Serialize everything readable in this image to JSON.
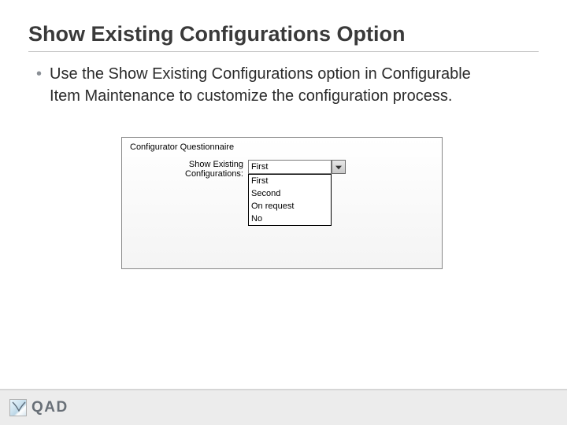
{
  "title": "Show Existing Configurations Option",
  "bullet": "•",
  "bullet_text": "Use the Show Existing Configurations option in Configurable Item Maintenance to customize the configuration process.",
  "panel": {
    "group_label": "Configurator Questionnaire",
    "field_label": "Show Existing Configurations:",
    "selected": "First",
    "options": [
      "First",
      "Second",
      "On request",
      "No"
    ]
  },
  "footer": {
    "brand": "QAD"
  }
}
